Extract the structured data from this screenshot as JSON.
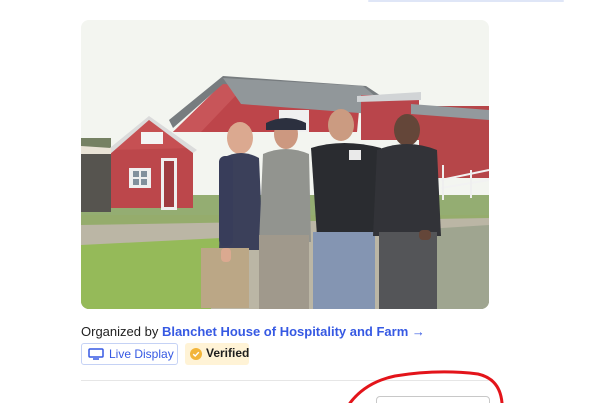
{
  "event_photo": {
    "alt": "Four men standing in front of a red barn"
  },
  "organizer": {
    "prefix": "Organized by",
    "name": "Blanchet House of Hospitality and Farm",
    "arrow": "→"
  },
  "badges": {
    "live_display_label": "Live Display",
    "live_display_icon": "monitor-icon",
    "verified_label": "Verified",
    "verified_icon": "check-circle-icon"
  },
  "colors": {
    "link_blue": "#3659e3",
    "verified_bg": "#fff3d6",
    "verified_icon": "#f2b53a",
    "annotation_red": "#e3141a"
  }
}
